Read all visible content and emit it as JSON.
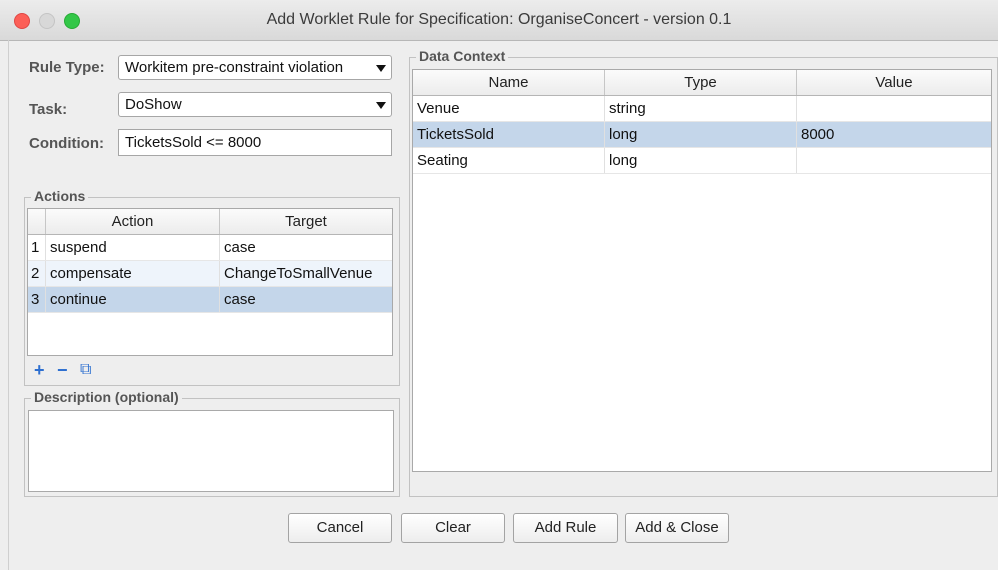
{
  "window": {
    "title": "Add Worklet Rule for Specification: OrganiseConcert - version 0.1"
  },
  "form": {
    "rule_type_label": "Rule Type:",
    "rule_type_value": "Workitem pre-constraint violation",
    "task_label": "Task:",
    "task_value": "DoShow",
    "condition_label": "Condition:",
    "condition_value": "TicketsSold <= 8000"
  },
  "actions": {
    "title": "Actions",
    "columns": [
      "",
      "Action",
      "Target"
    ],
    "rows": [
      {
        "num": "1",
        "action": "suspend",
        "target": "case"
      },
      {
        "num": "2",
        "action": "compensate",
        "target": "ChangeToSmallVenue"
      },
      {
        "num": "3",
        "action": "continue",
        "target": "case"
      }
    ],
    "add_icon": "+",
    "remove_icon": "−",
    "copy_icon": "⧉"
  },
  "description": {
    "title": "Description (optional)",
    "value": ""
  },
  "data_context": {
    "title": "Data Context",
    "columns": [
      "Name",
      "Type",
      "Value"
    ],
    "rows": [
      {
        "name": "Venue",
        "type": "string",
        "value": ""
      },
      {
        "name": "TicketsSold",
        "type": "long",
        "value": "8000"
      },
      {
        "name": "Seating",
        "type": "long",
        "value": ""
      }
    ]
  },
  "buttons": {
    "cancel": "Cancel",
    "clear": "Clear",
    "add_rule": "Add Rule",
    "add_close": "Add & Close"
  },
  "colors": {
    "selection": "#c4d6ea",
    "accent_icon": "#2d6fd0",
    "close": "#fc5f57",
    "maximize": "#33c748"
  }
}
